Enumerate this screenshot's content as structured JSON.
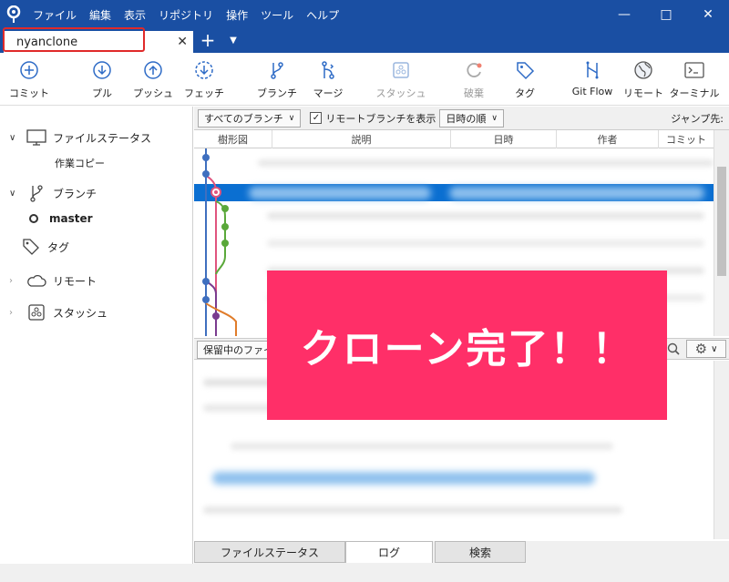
{
  "menu": [
    "ファイル",
    "編集",
    "表示",
    "リポジトリ",
    "操作",
    "ツール",
    "ヘルプ"
  ],
  "tab": {
    "label": "nyanclone"
  },
  "toolbar": [
    {
      "id": "commit",
      "label": "コミット",
      "icon": "plus-circle-icon",
      "disabled": false
    },
    {
      "id": "pull",
      "label": "プル",
      "icon": "arrow-down-circle-icon",
      "disabled": false
    },
    {
      "id": "push",
      "label": "プッシュ",
      "icon": "arrow-up-circle-icon",
      "disabled": false
    },
    {
      "id": "fetch",
      "label": "フェッチ",
      "icon": "fetch-dashed-circle-icon",
      "disabled": false
    },
    {
      "id": "branch",
      "label": "ブランチ",
      "icon": "branch-icon",
      "disabled": false
    },
    {
      "id": "merge",
      "label": "マージ",
      "icon": "merge-icon",
      "disabled": false
    },
    {
      "id": "stash",
      "label": "スタッシュ",
      "icon": "stash-icon",
      "disabled": true
    },
    {
      "id": "discard",
      "label": "破棄",
      "icon": "discard-icon",
      "disabled": true
    },
    {
      "id": "tag",
      "label": "タグ",
      "icon": "tag-icon",
      "disabled": false
    },
    {
      "id": "gitflow",
      "label": "Git Flow",
      "icon": "gitflow-icon",
      "disabled": false
    },
    {
      "id": "remote",
      "label": "リモート",
      "icon": "globe-icon",
      "disabled": false
    },
    {
      "id": "terminal",
      "label": "ターミナル",
      "icon": "terminal-icon",
      "disabled": false
    }
  ],
  "sidebar": {
    "file_status": "ファイルステータス",
    "working_copy": "作業コピー",
    "branches": "ブランチ",
    "master": "master",
    "tags": "タグ",
    "remotes": "リモート",
    "stashes": "スタッシュ"
  },
  "filters": {
    "branches": "すべてのブランチ",
    "show_remote": "リモートブランチを表示",
    "order": "日時の順",
    "jump": "ジャンプ先:"
  },
  "columns": [
    "樹形図",
    "説明",
    "日時",
    "作者",
    "コミット"
  ],
  "pending": {
    "label": "保留中のファイ"
  },
  "bottom_tabs": [
    "ファイルステータス",
    "ログ",
    "検索"
  ],
  "overlay": {
    "text": "クローン完了！！"
  },
  "colors": {
    "titlebar": "#1a4fa3",
    "selection": "#0b6fd1",
    "overlay": "#ff2f68",
    "highlight": "#e02a2a"
  }
}
